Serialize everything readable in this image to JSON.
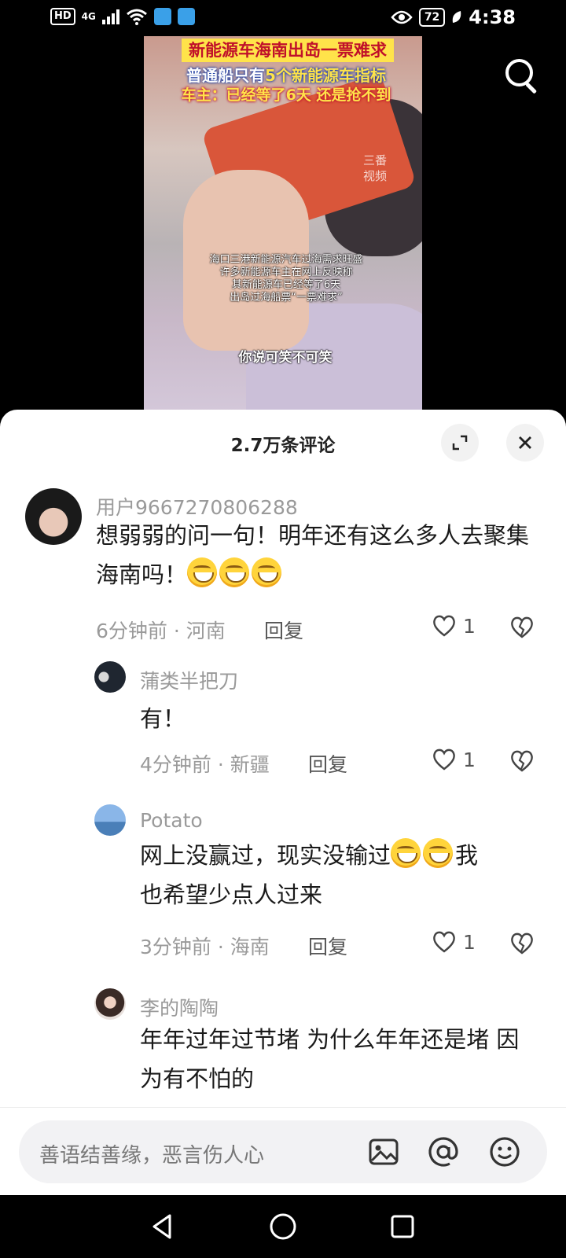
{
  "status_bar": {
    "network_badge": "HD",
    "network_type": "4G",
    "battery": "72",
    "time": "4:38"
  },
  "video": {
    "headline": "新能源车海南出岛一票难求",
    "subhead_pre": "普通船只有",
    "subhead_highlight": "5个新能源车指标",
    "subhead2": "车主：已经等了6天 还是抢不到",
    "watermark": "三番视频",
    "caption_lines": [
      "海口三港新能源汽车过海需求旺盛",
      "许多新能源车主在网上反映称",
      "其新能源车已经等了6天",
      "出岛过海船票“一票难求”"
    ],
    "quote": "你说可笑不可笑"
  },
  "comments_sheet": {
    "title": "2.7万条评论",
    "comments": [
      {
        "username": "用户9667270806288",
        "text": "想弱弱的问一句！明年还有这么多人去聚集海南吗！",
        "meta": "6分钟前 · 河南",
        "reply_label": "回复",
        "likes": "1"
      },
      {
        "username": "蒲类半把刀",
        "text": "有！",
        "meta": "4分钟前 · 新疆",
        "reply_label": "回复",
        "likes": "1"
      },
      {
        "username": "Potato",
        "text_a": "网上没赢过，现实没输过",
        "text_b": "我",
        "text_c": "也希望少点人过来",
        "meta": "3分钟前 · 海南",
        "reply_label": "回复",
        "likes": "1"
      },
      {
        "username": "李的陶陶",
        "text": "年年过年过节堵 为什么年年还是堵 因为有不怕的"
      }
    ]
  },
  "input_bar": {
    "placeholder": "善语结善缘，恶言伤人心"
  },
  "icons": {
    "search": "search-icon",
    "expand": "expand-icon",
    "close": "close-icon",
    "like": "heart-icon",
    "dislike": "broken-heart-icon",
    "image": "image-icon",
    "mention": "at-icon",
    "emoji": "smiley-icon"
  }
}
